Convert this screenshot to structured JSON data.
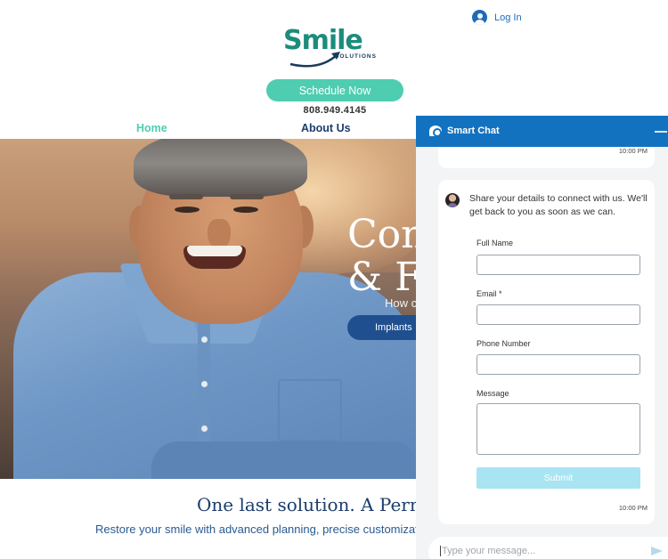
{
  "header": {
    "logo_text": "Smile",
    "logo_sub": "SOLUTIONS",
    "login_label": "Log In",
    "schedule_label": "Schedule Now",
    "phone": "808.949.4145"
  },
  "nav": {
    "items": [
      {
        "label": "Home",
        "active": true
      },
      {
        "label": "About Us",
        "active": false
      }
    ]
  },
  "hero": {
    "title_line1": "Con",
    "title_line2": "& F",
    "subtitle": "How c",
    "button_label": "Implants"
  },
  "content": {
    "tagline": "One last solution. A Perman",
    "subline": "Restore your smile with advanced planning, precise customizatio"
  },
  "chat": {
    "title": "Smart Chat",
    "prev_time": "10:00 PM",
    "message": "Share your details to connect with us. We'll get back to you as soon as we can.",
    "fields": [
      {
        "label": "Full Name"
      },
      {
        "label": "Email *"
      },
      {
        "label": "Phone Number"
      },
      {
        "label": "Message"
      }
    ],
    "submit_label": "Submit",
    "msg_time": "10:00 PM",
    "input_placeholder": "Type your message..."
  },
  "colors": {
    "brand_teal": "#4fcdb0",
    "brand_navy": "#1c3d6b",
    "chat_header": "#1372c0",
    "submit_disabled": "#a8e4f2"
  },
  "icons": [
    "user-circle-icon",
    "chat-bubble-icon",
    "minimize-icon",
    "send-icon"
  ]
}
